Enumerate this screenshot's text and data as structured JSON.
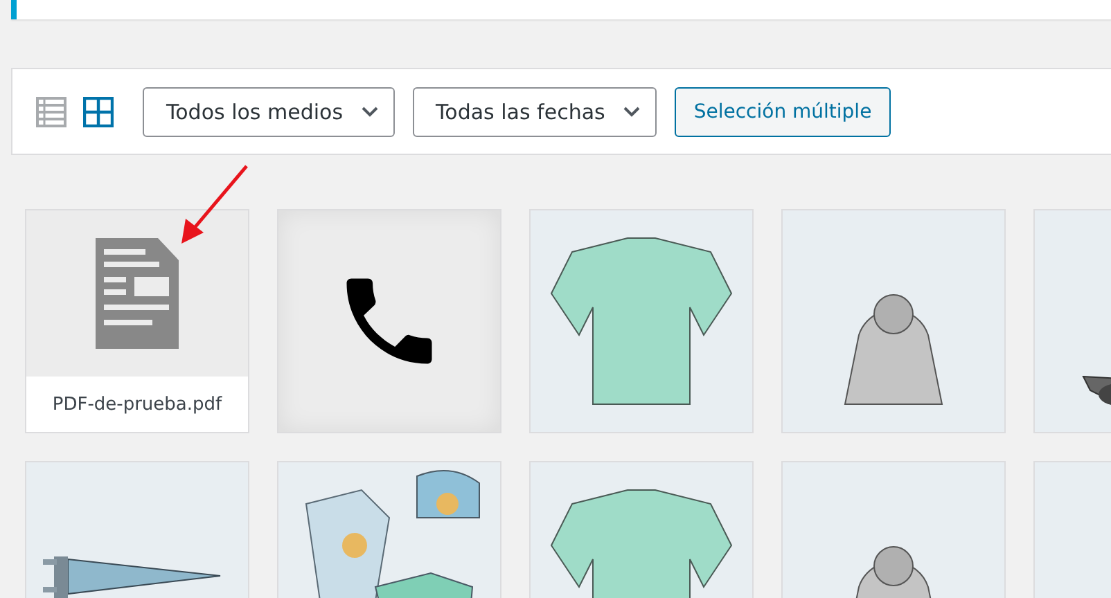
{
  "toolbar": {
    "view_modes": [
      {
        "kind": "list",
        "selected": false
      },
      {
        "kind": "grid",
        "selected": true
      }
    ],
    "filters": [
      {
        "label": "Todos los medios"
      },
      {
        "label": "Todas las fechas"
      }
    ],
    "bulk_select_button": "Selección múltiple"
  },
  "media_grid": [
    {
      "kind": "document",
      "filename": "PDF-de-prueba.pdf"
    },
    {
      "kind": "phone"
    },
    {
      "kind": "picture"
    },
    {
      "kind": "picture"
    },
    {
      "kind": "picture"
    },
    {
      "kind": "picture"
    },
    {
      "kind": "picture"
    },
    {
      "kind": "picture"
    },
    {
      "kind": "picture"
    },
    {
      "kind": "picture"
    }
  ]
}
